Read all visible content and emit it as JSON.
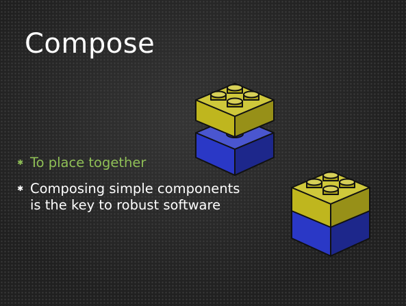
{
  "slide": {
    "title": "Compose",
    "bullets": [
      {
        "text": "To place together",
        "color": "#8fbf56"
      },
      {
        "text": "Composing simple components\nis the key to robust software",
        "color": "#ffffff"
      }
    ],
    "bullet_marker": "✱"
  },
  "colors": {
    "background": "#202020",
    "title": "#ffffff",
    "brick_yellow": "#c9c020",
    "brick_blue": "#2a38c6",
    "outline": "#111111"
  }
}
